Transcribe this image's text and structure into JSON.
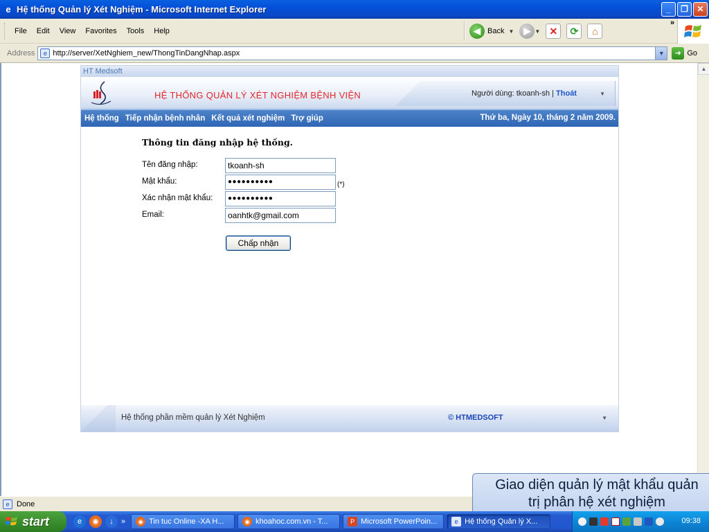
{
  "window": {
    "title": "Hệ thống Quản lý Xét Nghiệm - Microsoft Internet Explorer"
  },
  "menu": {
    "items": [
      "File",
      "Edit",
      "View",
      "Favorites",
      "Tools",
      "Help"
    ]
  },
  "toolbar": {
    "back_label": "Back",
    "chevron": "»"
  },
  "address": {
    "label": "Address",
    "url": "http://server/XetNghiem_new/ThongTinDangNhap.aspx",
    "go_label": "Go"
  },
  "site": {
    "brand": "HT Medsoft",
    "system_title": "HỆ THỐNG QUẢN LÝ XÉT NGHIỆM BỆNH VIỆN",
    "user_label": "Người dùng:",
    "user_name": "tkoanh-sh",
    "user_sep": "|",
    "logout": "Thoát",
    "nav": [
      "Hệ thống",
      "Tiếp nhận bệnh nhân",
      "Kết quả xét nghiệm",
      "Trợ giúp"
    ],
    "date": "Thứ ba, Ngày 10, tháng 2 năm 2009."
  },
  "form": {
    "title": "Thông tin đăng nhập hệ thống.",
    "username_label": "Tên đăng nhập:",
    "username_value": "tkoanh-sh",
    "password_label": "Mật khẩu:",
    "password_value": "●●●●●●●●●●",
    "required_mark": "(*)",
    "confirm_label": "Xác nhận mật khẩu:",
    "confirm_value": "●●●●●●●●●●",
    "email_label": "Email:",
    "email_value": "oanhtk@gmail.com",
    "submit_label": "Chấp nhận"
  },
  "footer": {
    "text": "Hệ thống phần mềm quản lý Xét Nghiệm",
    "copyright": "© HTMEDSOFT"
  },
  "status": {
    "text": "Done"
  },
  "caption": {
    "text": "Giao diện quản lý mật khẩu quản\ntrị phân hệ xét nghiệm"
  },
  "taskbar": {
    "start_label": "start",
    "tasks": [
      {
        "label": "Tin tuc Online -XA H..."
      },
      {
        "label": "khoahoc.com.vn - T..."
      },
      {
        "label": "Microsoft PowerPoin..."
      },
      {
        "label": "Hệ thống Quản lý X..."
      }
    ],
    "clock": "09:38"
  }
}
